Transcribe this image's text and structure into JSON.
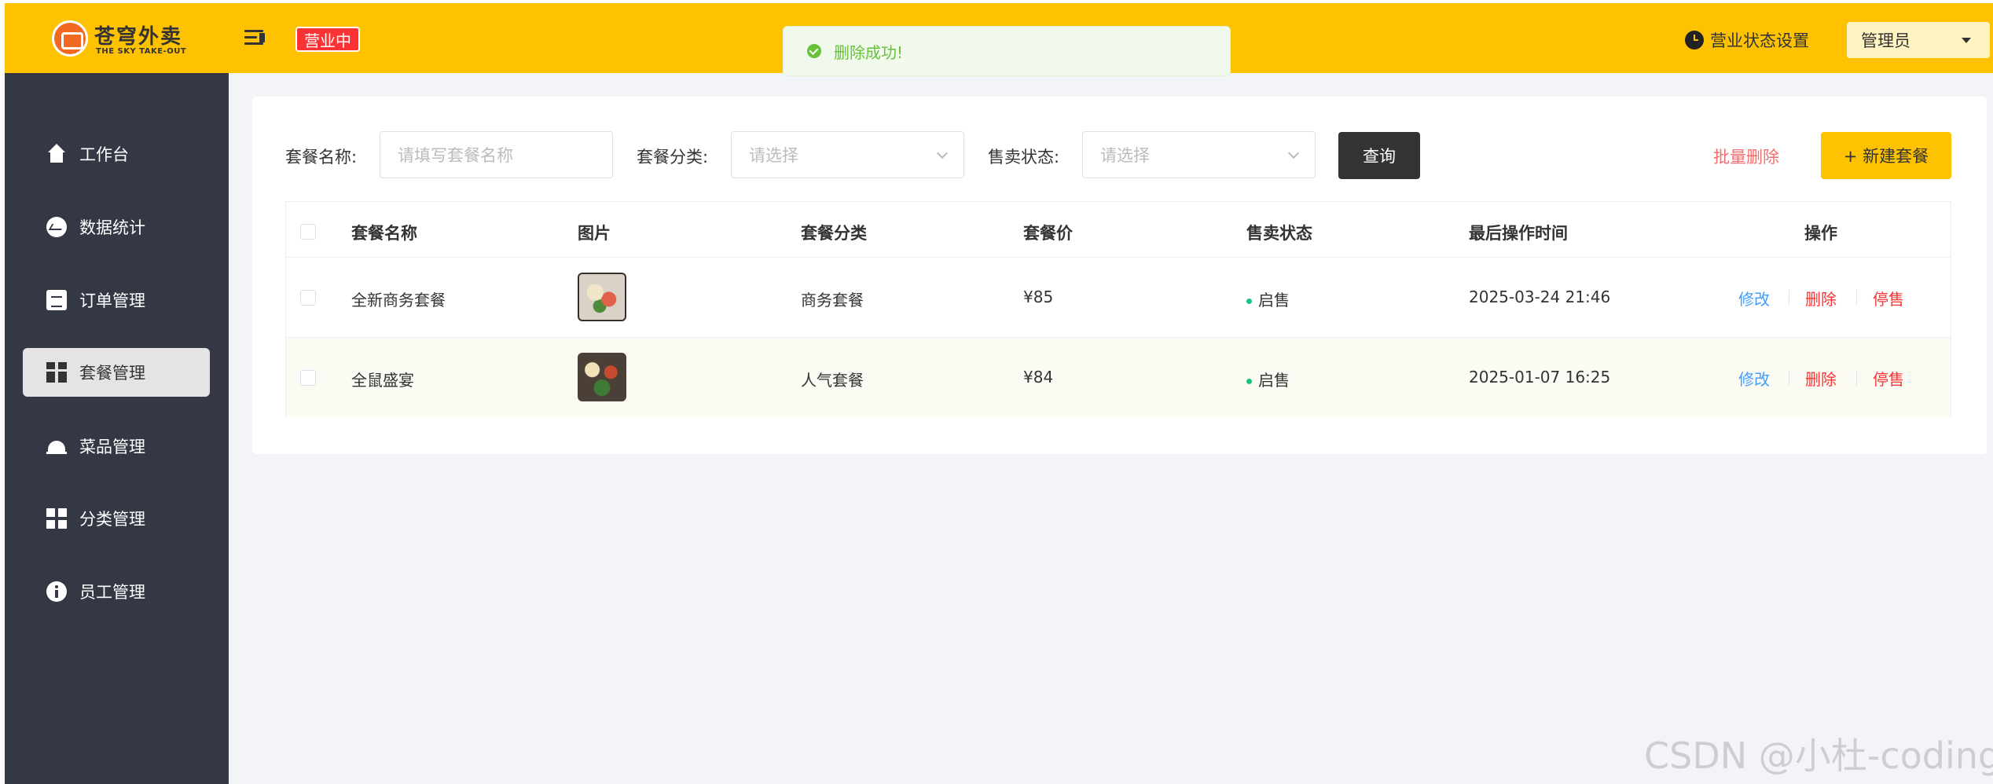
{
  "header": {
    "brand_title": "苍穹外卖",
    "brand_subtitle": "THE SKY TAKE-OUT",
    "status_badge": "营业中",
    "business_setting": "营业状态设置",
    "user": "管理员",
    "accent_color": "#ffc200"
  },
  "toast": {
    "message": "删除成功!",
    "icon": "check-circle-icon",
    "color": "#67c23a"
  },
  "sidebar": {
    "items": [
      {
        "label": "工作台",
        "icon": "home-icon",
        "active": false
      },
      {
        "label": "数据统计",
        "icon": "chart-icon",
        "active": false
      },
      {
        "label": "订单管理",
        "icon": "clipboard-icon",
        "active": false
      },
      {
        "label": "套餐管理",
        "icon": "gift-icon",
        "active": true
      },
      {
        "label": "菜品管理",
        "icon": "dish-cover-icon",
        "active": false
      },
      {
        "label": "分类管理",
        "icon": "grid-icon",
        "active": false
      },
      {
        "label": "员工管理",
        "icon": "info-icon",
        "active": false
      }
    ]
  },
  "filters": {
    "name_label": "套餐名称:",
    "name_placeholder": "请填写套餐名称",
    "category_label": "套餐分类:",
    "category_placeholder": "请选择",
    "status_label": "售卖状态:",
    "status_placeholder": "请选择",
    "query_button": "查询",
    "batch_delete": "批量删除",
    "new_button": "+ 新建套餐"
  },
  "table": {
    "columns": [
      "套餐名称",
      "图片",
      "套餐分类",
      "套餐价",
      "售卖状态",
      "最后操作时间",
      "操作"
    ],
    "rows": [
      {
        "name": "全新商务套餐",
        "category": "商务套餐",
        "price": "¥85",
        "status": "启售",
        "time": "2025-03-24 21:46",
        "edit": "修改",
        "delete": "删除",
        "stop": "停售"
      },
      {
        "name": "全鼠盛宴",
        "category": "人气套餐",
        "price": "¥84",
        "status": "启售",
        "time": "2025-01-07 16:25",
        "edit": "修改",
        "delete": "删除",
        "stop": "停售"
      }
    ]
  },
  "watermark": "CSDN @小杜-coding"
}
